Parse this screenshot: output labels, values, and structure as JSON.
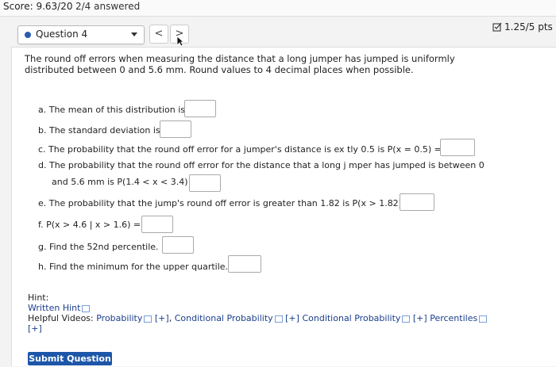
{
  "header": {
    "score": "Score: 9.63/20",
    "answered": "2/4 answered"
  },
  "question_selector": {
    "label": "Question 4",
    "prev": "<",
    "next": ">"
  },
  "points": "1.25/5 pts",
  "problem": "The round off errors when measuring the distance that a long jumper has jumped is uniformly distributed between 0 and 5.6 mm. Round values to 4 decimal places when possible.",
  "parts": [
    {
      "text": "a. The mean of this distribution is"
    },
    {
      "text": "b. The standard deviation is"
    },
    {
      "text": "c. The probability that the round off error for a jumper's distance is ex   tly 0.5 is P(x = 0.5) ="
    },
    {
      "text": "d. The probability that the round off error for the distance that a long j  mper has jumped is between 0"
    },
    {
      "text": "and 5.6 mm is P(1.4 < x < 3.4) ="
    },
    {
      "text": "e. The probability that the jump's round off error is greater than 1.82 is P(x > 1.82) ="
    },
    {
      "text": "f. P(x > 4.6 | x > 1.6) ="
    },
    {
      "text": "g. Find the 52nd percentile."
    },
    {
      "text": "h. Find the minimum for the upper quartile."
    }
  ],
  "hint": {
    "title": "Hint:",
    "written": "Written Hint",
    "videos_label": "Helpful Videos:",
    "v1": "Probability",
    "v2": "Conditional Probability",
    "v3": "Conditional Probability",
    "v4": "Percentiles",
    "plus": "[+]"
  },
  "submit": "Submit Question"
}
